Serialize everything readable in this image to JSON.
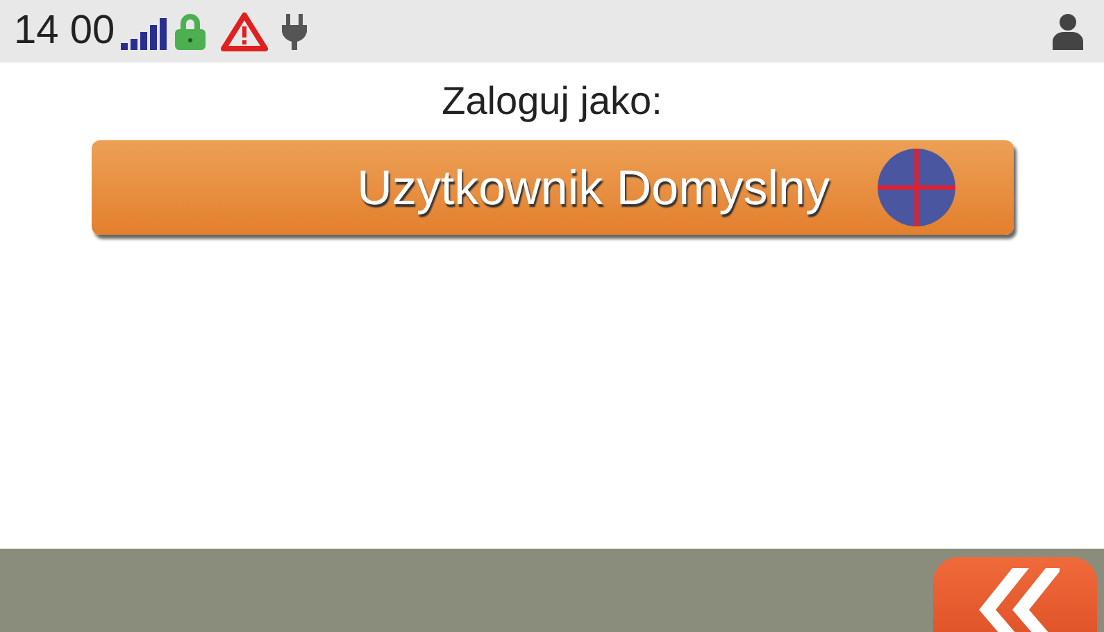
{
  "status_bar": {
    "time": "14 00"
  },
  "prompt": "Zaloguj jako:",
  "users": [
    {
      "name": "Uzytkownik Domyslny"
    }
  ]
}
